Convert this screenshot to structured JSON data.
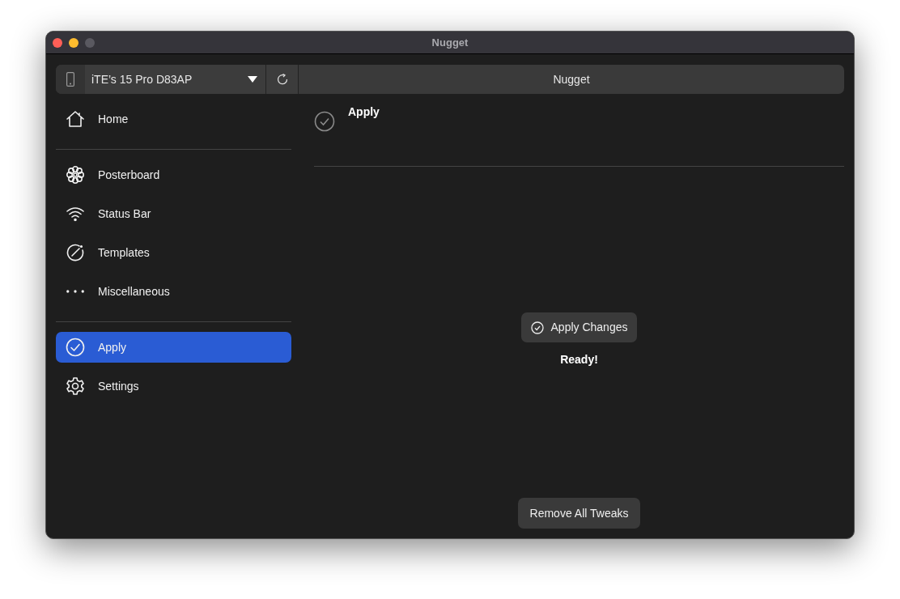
{
  "window": {
    "title": "Nugget"
  },
  "toolbar": {
    "device": "iTE’s 15 Pro D83AP",
    "title": "Nugget"
  },
  "sidebar": {
    "sections": [
      {
        "items": [
          {
            "label": "Home",
            "selected": false
          }
        ]
      },
      {
        "items": [
          {
            "label": "Posterboard",
            "selected": false
          },
          {
            "label": "Status Bar",
            "selected": false
          },
          {
            "label": "Templates",
            "selected": false
          },
          {
            "label": "Miscellaneous",
            "selected": false
          }
        ]
      },
      {
        "items": [
          {
            "label": "Apply",
            "selected": true
          },
          {
            "label": "Settings",
            "selected": false
          }
        ]
      }
    ]
  },
  "content": {
    "title": "Apply",
    "apply_button": "Apply Changes",
    "status": "Ready!",
    "remove_button": "Remove All Tweaks"
  }
}
